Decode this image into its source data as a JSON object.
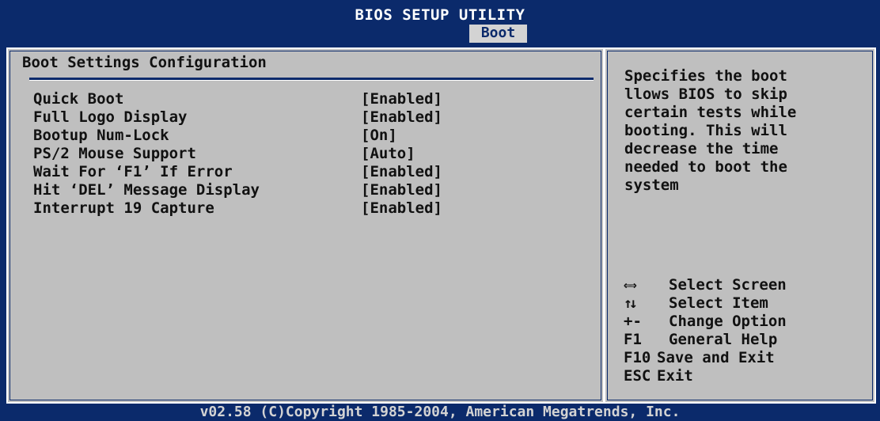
{
  "header": {
    "title": "BIOS SETUP UTILITY",
    "active_tab": "Boot"
  },
  "main": {
    "section_title": "Boot Settings Configuration",
    "settings": [
      {
        "name": "Quick Boot",
        "value": "[Enabled]"
      },
      {
        "name": "Full Logo Display",
        "value": "[Enabled]"
      },
      {
        "name": "Bootup Num-Lock",
        "value": "[On]"
      },
      {
        "name": "PS/2 Mouse Support",
        "value": "[Auto]"
      },
      {
        "name": "Wait For ‘F1’ If Error",
        "value": "[Enabled]"
      },
      {
        "name": "Hit ‘DEL’ Message Display",
        "value": "[Enabled]"
      },
      {
        "name": "Interrupt 19 Capture",
        "value": "[Enabled]"
      }
    ]
  },
  "help": {
    "text": "Specifies the boot\nllows BIOS to skip\ncertain tests while\nbooting. This will\ndecrease the time\nneeded to boot the\nsystem"
  },
  "keys": [
    {
      "icon": "left-right-arrow-icon",
      "key": "",
      "label": "Select Screen"
    },
    {
      "icon": "up-down-arrow-icon",
      "key": "",
      "label": "Select Item"
    },
    {
      "icon": "",
      "key": "+-",
      "label": "Change Option"
    },
    {
      "icon": "",
      "key": "F1",
      "label": "General Help"
    },
    {
      "icon": "",
      "key": "F10",
      "label": "Save and Exit"
    },
    {
      "icon": "",
      "key": "ESC",
      "label": "Exit"
    }
  ],
  "footer": {
    "copyright": "v02.58 (C)Copyright 1985-2004, American Megatrends, Inc."
  },
  "colors": {
    "background": "#0b2a6b",
    "panel": "#bfbfbf",
    "text": "#111111",
    "tab_bg": "#d3d3d3"
  }
}
